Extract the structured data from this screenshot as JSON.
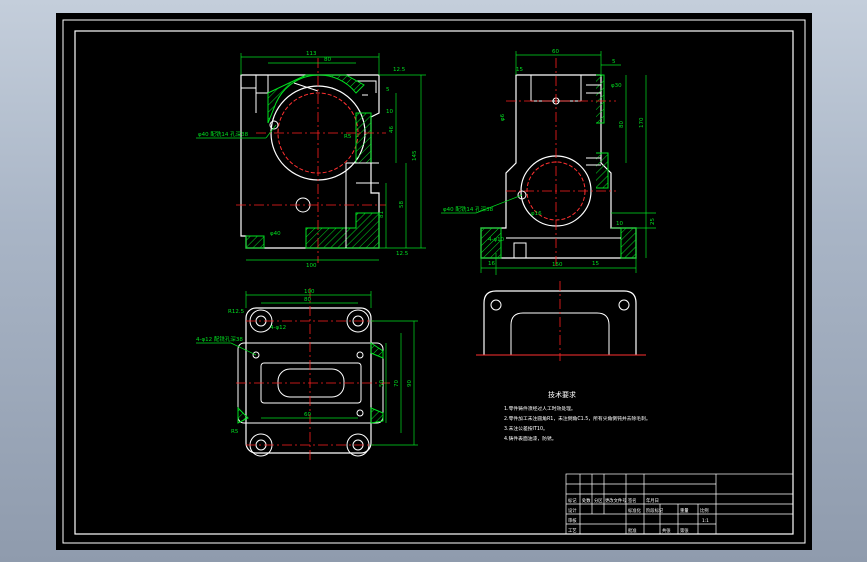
{
  "viewer": {
    "background": "#a9b5c6",
    "sheet_color": "#000000"
  },
  "colors": {
    "outline": "#ffffff",
    "centerline": "#ff2020",
    "dimension": "#00e020",
    "hatch": "#00e020",
    "hidden": "#ff3030",
    "border": "#ffffff"
  },
  "views": {
    "front": {
      "dims": {
        "top_width": "113",
        "top_inner": "80",
        "right_top": "12.5",
        "right_a": "5",
        "right_b": "10",
        "bottom_width": "100",
        "bottom_right": "12.5",
        "height_total": "145",
        "height_a": "46",
        "height_b": "58",
        "height_c": "81",
        "chamfer": "R5",
        "left_note": "φ40"
      },
      "hole_label": "φ40 配铣14 孔深38"
    },
    "side": {
      "dims": {
        "top_width": "60",
        "top_small": "15",
        "top_right": "5",
        "right_a": "φ30",
        "right_b": "80",
        "right_c": "170",
        "left_mid": "φ6",
        "bottom_width": "150",
        "bottom_left": "16",
        "bottom_right": "15",
        "height_a": "25",
        "height_b": "10",
        "small_note": "4-φ10",
        "bolt": "φ16"
      },
      "hole_label": "φ40 配铣14 孔深38"
    },
    "top": {
      "dims": {
        "top_width": "100",
        "inner_width": "80",
        "r_label": "R12.5",
        "height_a": "50",
        "height_b": "70",
        "height_c": "90",
        "left_note": "4-φ12",
        "bottom_left": "R5",
        "bottom_mid": "60"
      },
      "hole_label": "4-φ12 配铣孔深38"
    }
  },
  "notes": {
    "title": "技术要求",
    "lines": [
      "1.零件铸件须经过人工时效处理。",
      "2.零件加工未注圆角R1，未注倒角C1.5，所有尖角倒钝并去除毛刺。",
      "3.未注公差按IT10。",
      "4.铸件表面油漆，防锈。"
    ]
  },
  "title_block": {
    "cells": [
      "标记",
      "处数",
      "分区",
      "更改文件号",
      "签名",
      "年月日",
      "设计",
      "标准化",
      "阶段标记",
      "重量",
      "比例",
      "审核",
      "工艺",
      "批准",
      "共张",
      "第张",
      "1:1"
    ]
  }
}
